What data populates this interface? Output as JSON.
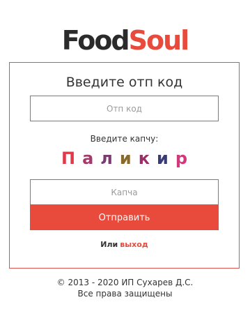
{
  "logo": {
    "part1": "Food",
    "part2": "Soul"
  },
  "form": {
    "title": "Введите отп код",
    "otp_placeholder": "Отп код",
    "captcha_label": "Введите капчу:",
    "captcha_chars": [
      {
        "char": "П",
        "color": "#e03a4a"
      },
      {
        "char": "а",
        "color": "#a33a6a"
      },
      {
        "char": "л",
        "color": "#7a3b6e"
      },
      {
        "char": "и",
        "color": "#8a6a2a"
      },
      {
        "char": "к",
        "color": "#9a2f66"
      },
      {
        "char": "и",
        "color": "#3b3b73"
      },
      {
        "char": "р",
        "color": "#d2397a"
      }
    ],
    "captcha_placeholder": "Капча",
    "submit_label": "Отправить",
    "alt_prefix": "Или",
    "alt_link": "выход"
  },
  "footer": {
    "line1": "© 2013 - 2020 ИП Сухарев Д.С.",
    "line2": "Все права защищены"
  },
  "colors": {
    "accent": "#e84b3c",
    "border": "#d9534f"
  }
}
